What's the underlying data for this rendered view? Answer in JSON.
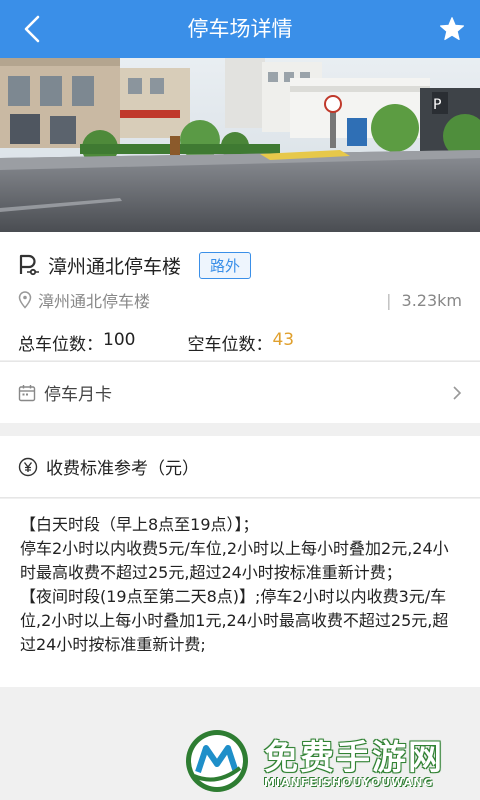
{
  "header": {
    "title": "停车场详情"
  },
  "lot": {
    "name": "漳州通北停车楼",
    "type_badge": "路外",
    "address": "漳州通北停车楼",
    "distance": "3.23km",
    "total_label": "总车位数：",
    "total_value": "100",
    "free_label": "空车位数：",
    "free_value": "43"
  },
  "monthly_card": {
    "label": "停车月卡"
  },
  "fee": {
    "title": "收费标准参考（元）",
    "lines": [
      "【白天时段（早上8点至19点）】；",
      "停车2小时以内收费5元/车位,2小时以上每小时叠加2元,24小时最高收费不超过25元,超过24小时按标准重新计费；",
      "【夜间时段(19点至第二天8点)】;停车2小时以内收费3元/车位,2小时以上每小时叠加1元,24小时最高收费不超过25元,超过24小时按标准重新计费;"
    ]
  },
  "watermark": {
    "cn": "免费手游网",
    "en": "MIANFEISHOUYOUWANG"
  },
  "colors": {
    "header": "#3a8fe8",
    "accent": "#3a8fe8",
    "available": "#e0a02e"
  },
  "icons": [
    "back-arrow-icon",
    "star-icon",
    "parking-icon",
    "location-pin-icon",
    "calendar-icon",
    "chevron-right-icon",
    "yen-icon"
  ]
}
